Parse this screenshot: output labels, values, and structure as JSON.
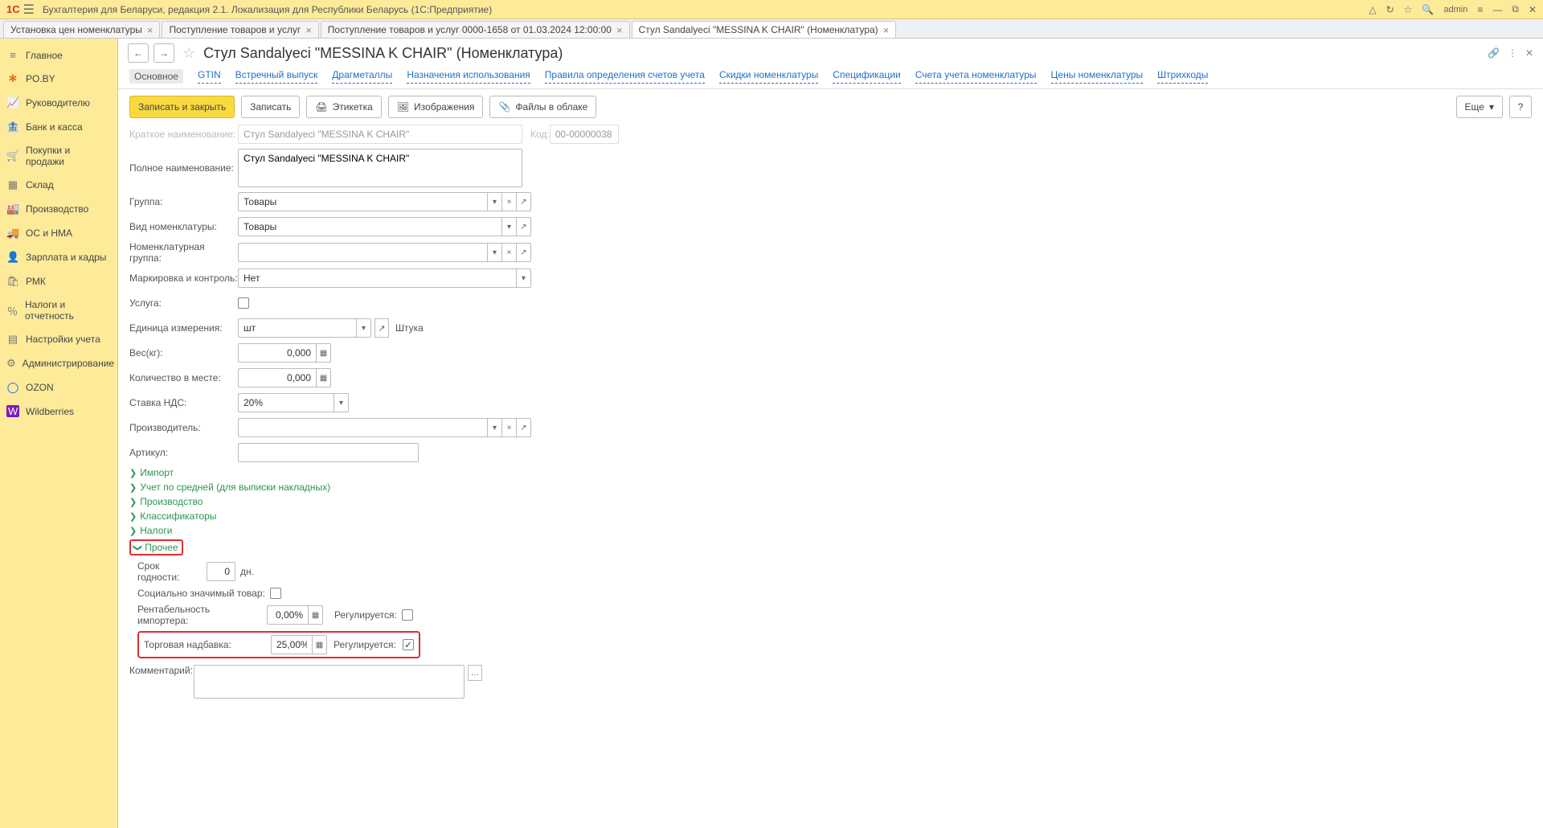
{
  "titlebar": {
    "logo": "1C",
    "title": "Бухгалтерия для Беларуси, редакция 2.1. Локализация для Республики Беларусь   (1С:Предприятие)",
    "user": "admin"
  },
  "tabs": [
    {
      "label": "Установка цен номенклатуры"
    },
    {
      "label": "Поступление товаров и услуг"
    },
    {
      "label": "Поступление товаров и услуг 0000-1658 от 01.03.2024 12:00:00"
    },
    {
      "label": "Стул Sandalyeci \"MESSINA K CHAIR\" (Номенклатура)",
      "active": true
    }
  ],
  "sidebar": [
    {
      "icon": "≡",
      "label": "Главное"
    },
    {
      "icon": "✱",
      "label": "PO.BY",
      "orange": true
    },
    {
      "icon": "📈",
      "label": "Руководителю"
    },
    {
      "icon": "🏦",
      "label": "Банк и касса"
    },
    {
      "icon": "🛒",
      "label": "Покупки и продажи"
    },
    {
      "icon": "▦",
      "label": "Склад"
    },
    {
      "icon": "🏭",
      "label": "Производство"
    },
    {
      "icon": "🚚",
      "label": "ОС и НМА"
    },
    {
      "icon": "👤",
      "label": "Зарплата и кадры"
    },
    {
      "icon": "🛍",
      "label": "РМК"
    },
    {
      "icon": "％",
      "label": "Налоги и отчетность"
    },
    {
      "icon": "▤",
      "label": "Настройки учета"
    },
    {
      "icon": "⚙",
      "label": "Администрирование"
    },
    {
      "icon": "◯",
      "label": "OZON"
    },
    {
      "icon": "W",
      "label": "Wildberries"
    }
  ],
  "page": {
    "title": "Стул Sandalyeci \"MESSINA K CHAIR\" (Номенклатура)",
    "tabs": [
      "Основное",
      "GTIN",
      "Встречный выпуск",
      "Драгметаллы",
      "Назначения использования",
      "Правила определения счетов учета",
      "Скидки номенклатуры",
      "Спецификации",
      "Счета учета номенклатуры",
      "Цены номенклатуры",
      "Штрихкоды"
    ]
  },
  "toolbar": {
    "save_close": "Записать и закрыть",
    "save": "Записать",
    "label": "Этикетка",
    "images": "Изображения",
    "cloud": "Файлы в облаке",
    "more": "Еще"
  },
  "form": {
    "short_name_label": "Краткое наименование:",
    "short_name": "Стул Sandalyeci \"MESSINA K CHAIR\"",
    "code_label": "Код:",
    "code": "00-00000038",
    "full_name_label": "Полное наименование:",
    "full_name": "Стул Sandalyeci \"MESSINA K CHAIR\"",
    "group_label": "Группа:",
    "group": "Товары",
    "type_label": "Вид номенклатуры:",
    "type": "Товары",
    "nom_group_label": "Номенклатурная группа:",
    "nom_group": "",
    "marking_label": "Маркировка и контроль:",
    "marking": "Нет",
    "service_label": "Услуга:",
    "unit_label": "Единица измерения:",
    "unit": "шт",
    "unit_desc": "Штука",
    "weight_label": "Вес(кг):",
    "weight": "0,000",
    "qty_label": "Количество в месте:",
    "qty": "0,000",
    "vat_label": "Ставка НДС:",
    "vat": "20%",
    "producer_label": "Производитель:",
    "producer": "",
    "article_label": "Артикул:",
    "article": "",
    "comment_label": "Комментарий:"
  },
  "expand": {
    "import": "Импорт",
    "avg": "Учет по средней (для выписки накладных)",
    "prod": "Производство",
    "class": "Классификаторы",
    "tax": "Налоги",
    "other": "Прочее"
  },
  "other": {
    "shelf_label": "Срок годности:",
    "shelf": "0",
    "shelf_unit": "дн.",
    "social_label": "Социально значимый товар:",
    "rent_label": "Рентабельность импортера:",
    "rent": "0,00%",
    "reg_label": "Регулируется:",
    "markup_label": "Торговая надбавка:",
    "markup": "25,00%"
  }
}
